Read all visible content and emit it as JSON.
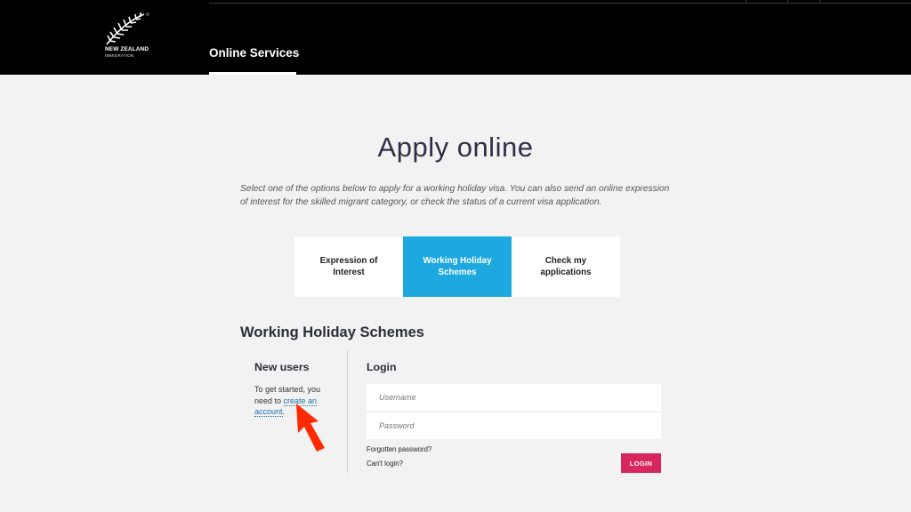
{
  "header": {
    "logo_brand": "NEW ZEALAND",
    "logo_sub": "IMMIGRATION",
    "nav_title": "Online Services"
  },
  "main": {
    "title": "Apply online",
    "intro": "Select one of the options below to apply for a working holiday visa. You can also send an online expression of interest for the skilled migrant category, or check the status of a current visa application.",
    "tabs": [
      {
        "label": "Expression of Interest",
        "active": false
      },
      {
        "label": "Working Holiday Schemes",
        "active": true
      },
      {
        "label": "Check my applications",
        "active": false
      }
    ],
    "section_title": "Working Holiday Schemes"
  },
  "new_users": {
    "heading": "New users",
    "text_prefix": "To get started, you need to ",
    "link": "create an account",
    "text_suffix": "."
  },
  "login": {
    "heading": "Login",
    "username_placeholder": "Username",
    "password_placeholder": "Password",
    "forgot": "Forgotten password?",
    "cant_login": "Can't login?",
    "button": "LOGIN"
  },
  "colors": {
    "header_bg": "#000000",
    "page_bg": "#f2f2f2",
    "active_tab": "#1ea8e0",
    "login_button": "#d8265f",
    "link": "#1c6fa8",
    "annotation_arrow": "#ff2a00"
  },
  "icons": {
    "logo": "silver-fern-logo",
    "annotation": "red-arrow-annotation"
  }
}
